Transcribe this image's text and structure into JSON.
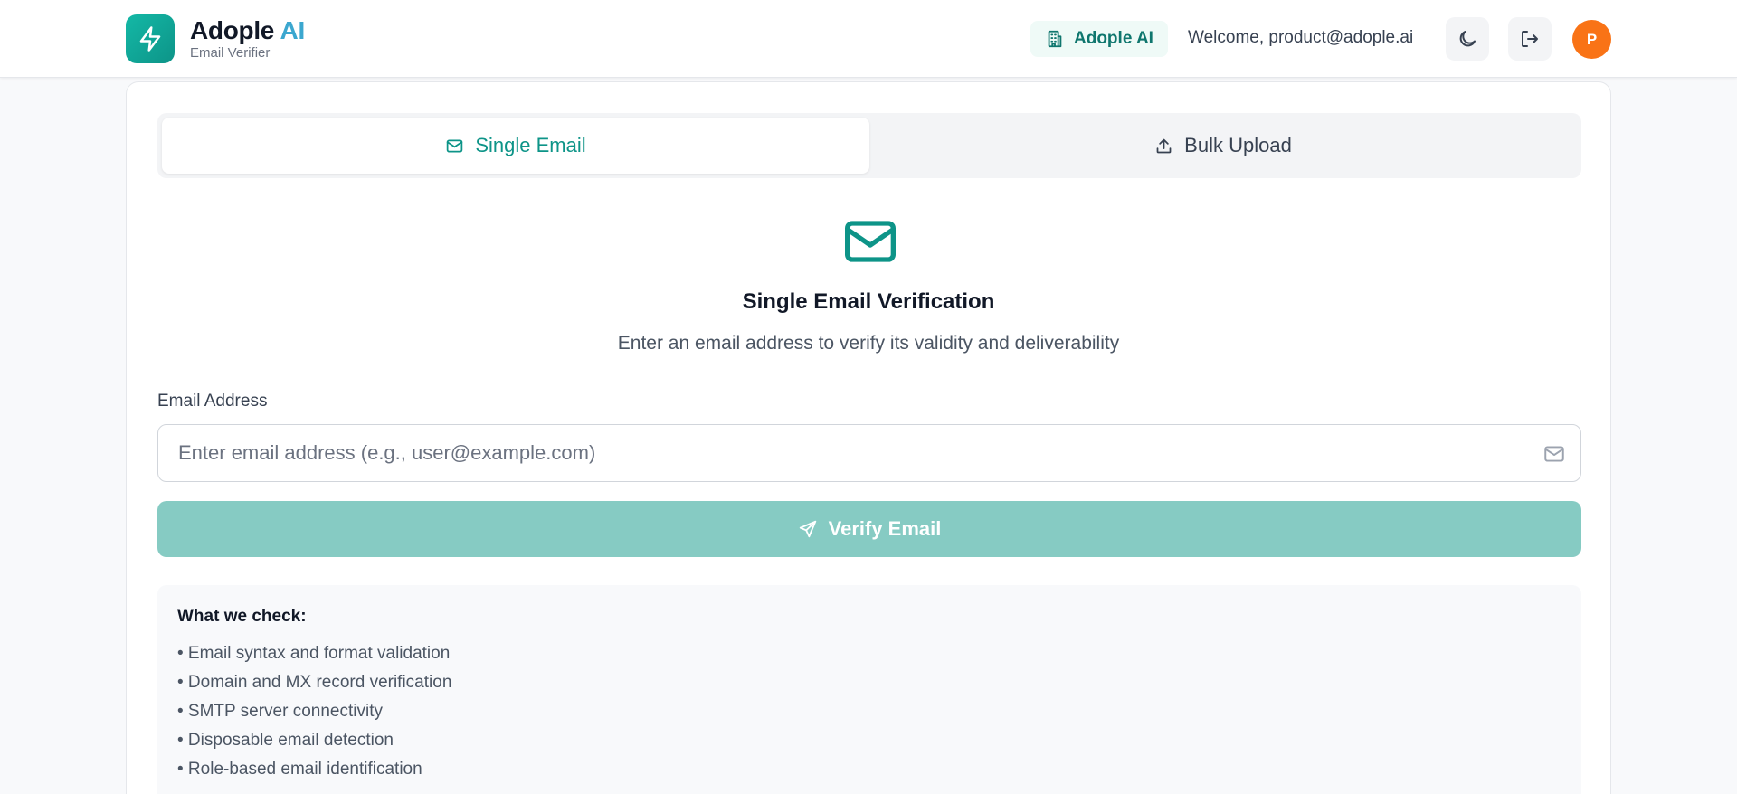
{
  "header": {
    "brand_name": "Adople",
    "brand_ai": "AI",
    "brand_subtitle": "Email Verifier",
    "org_label": "Adople AI",
    "welcome_text": "Welcome, product@adople.ai",
    "avatar_initial": "P"
  },
  "tabs": [
    {
      "label": "Single Email",
      "icon": "mail-icon",
      "active": true
    },
    {
      "label": "Bulk Upload",
      "icon": "upload-icon",
      "active": false
    }
  ],
  "main": {
    "title": "Single Email Verification",
    "subtitle": "Enter an email address to verify its validity and deliverability",
    "field_label": "Email Address",
    "input_placeholder": "Enter email address (e.g., user@example.com)",
    "input_value": "",
    "verify_label": "Verify Email"
  },
  "checks": {
    "title": "What we check:",
    "items": [
      "• Email syntax and format validation",
      "• Domain and MX record verification",
      "• SMTP server connectivity",
      "• Disposable email detection",
      "• Role-based email identification"
    ]
  },
  "colors": {
    "accent": "#0d9488",
    "brand_ai": "#3ba7cf",
    "button_disabled": "#86cbc3",
    "avatar": "#f97316"
  }
}
